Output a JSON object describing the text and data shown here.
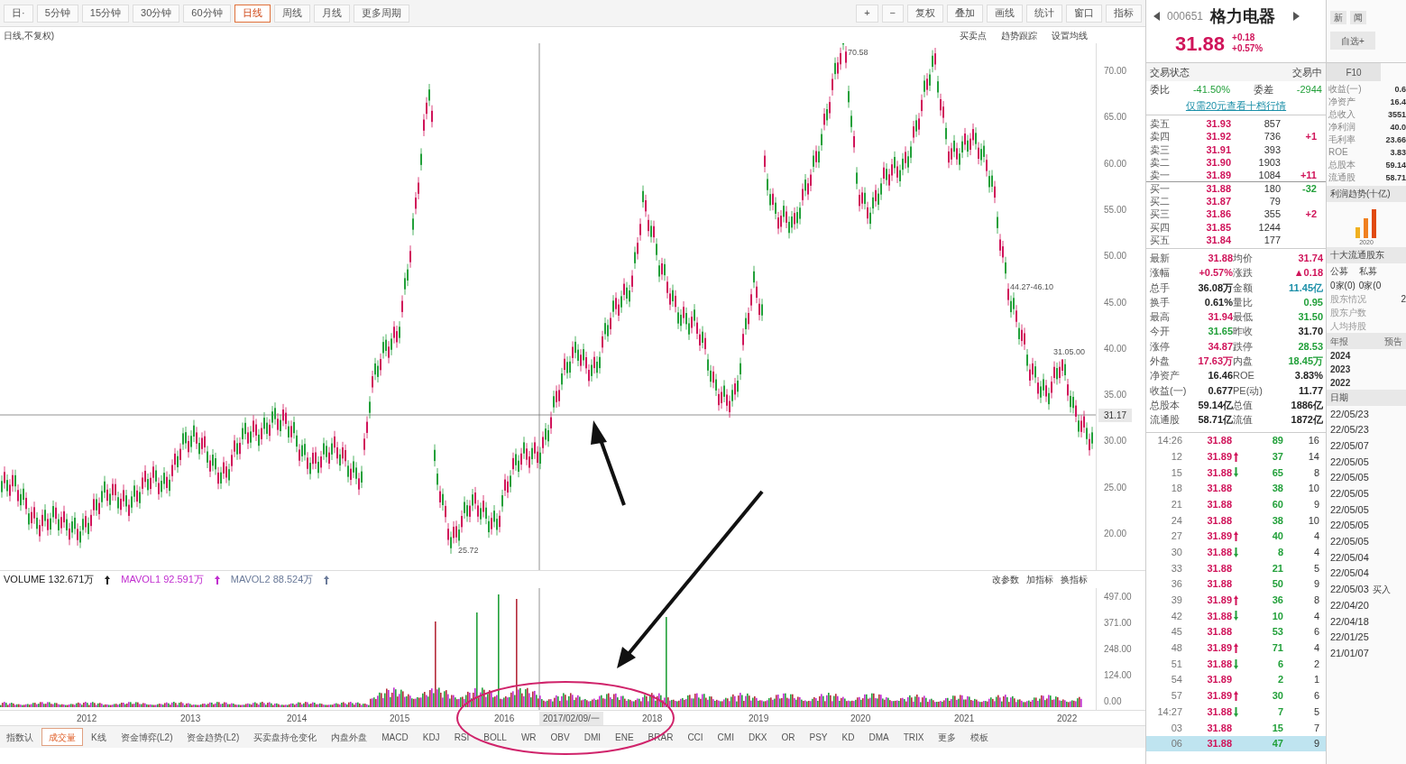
{
  "toolbar": {
    "periods": [
      {
        "label": "日·",
        "selected": false
      },
      {
        "label": "5分钟",
        "selected": false
      },
      {
        "label": "15分钟",
        "selected": false
      },
      {
        "label": "30分钟",
        "selected": false
      },
      {
        "label": "60分钟",
        "selected": false
      },
      {
        "label": "日线",
        "selected": true
      },
      {
        "label": "周线",
        "selected": false
      },
      {
        "label": "月线",
        "selected": false
      },
      {
        "label": "更多周期",
        "selected": false
      }
    ],
    "tools": [
      "+",
      "−",
      "复权",
      "叠加",
      "画线",
      "统计",
      "窗口",
      "指标"
    ]
  },
  "chart_header": {
    "title": "日线,不复权)",
    "options": [
      "买卖点",
      "趋势跟踪",
      "设置均线"
    ]
  },
  "price_chart": {
    "y_labels": [
      "70.00",
      "65.00",
      "60.00",
      "55.00",
      "50.00",
      "45.00",
      "40.00",
      "35.00",
      "30.00",
      "25.00",
      "20.00"
    ],
    "crosshair_price": "31.17",
    "high_label": "70.58",
    "low_label": "25.72",
    "range_label": "44.27-46.10",
    "level_label": "31.05.00"
  },
  "volume_panel": {
    "indicators": [
      {
        "label": "VOLUME 132.671万",
        "color": "#222222"
      },
      {
        "label": "MAVOL1 92.591万",
        "color": "#c02ccf"
      },
      {
        "label": "MAVOL2 88.524万",
        "color": "#6a7a99"
      }
    ],
    "buttons": [
      "改参数",
      "加指标",
      "换指标"
    ],
    "y_labels": [
      "497.00",
      "371.00",
      "248.00",
      "124.00",
      "0.00"
    ]
  },
  "x_axis": {
    "years": [
      "2012",
      "2013",
      "2014",
      "2015",
      "2016",
      "2018",
      "2019",
      "2020",
      "2021",
      "2022"
    ],
    "crosshair_date": "2017/02/09/一"
  },
  "bottom_tabs": [
    {
      "label": "指数认",
      "selected": false
    },
    {
      "label": "成交量",
      "selected": true
    },
    {
      "label": "K线",
      "selected": false
    },
    {
      "label": "资金博弈(L2)",
      "selected": false
    },
    {
      "label": "资金趋势(L2)",
      "selected": false
    },
    {
      "label": "买卖盘持仓变化",
      "selected": false
    },
    {
      "label": "内盘外盘",
      "selected": false
    },
    {
      "label": "MACD",
      "selected": false
    },
    {
      "label": "KDJ",
      "selected": false
    },
    {
      "label": "RSI",
      "selected": false
    },
    {
      "label": "BOLL",
      "selected": false
    },
    {
      "label": "WR",
      "selected": false
    },
    {
      "label": "OBV",
      "selected": false
    },
    {
      "label": "DMI",
      "selected": false
    },
    {
      "label": "ENE",
      "selected": false
    },
    {
      "label": "BRAR",
      "selected": false
    },
    {
      "label": "CCI",
      "selected": false
    },
    {
      "label": "CMI",
      "selected": false
    },
    {
      "label": "DKX",
      "selected": false
    },
    {
      "label": "OR",
      "selected": false
    },
    {
      "label": "PSY",
      "selected": false
    },
    {
      "label": "KD",
      "selected": false
    },
    {
      "label": "DMA",
      "selected": false
    },
    {
      "label": "TRIX",
      "selected": false
    },
    {
      "label": "更多",
      "selected": false
    },
    {
      "label": "模板",
      "selected": false
    }
  ],
  "quote": {
    "code": "000651",
    "name": "格力电器",
    "price": "31.88",
    "change": "+0.18",
    "change_pct": "+0.57%",
    "status_label": "交易状态",
    "status": "交易中",
    "ratio": [
      {
        "label": "委比",
        "value": "-41.50%"
      },
      {
        "label": "委差",
        "value": "-2944"
      }
    ],
    "link": "仅需20元查看十档行情",
    "orders": [
      {
        "label": "卖五",
        "price": "31.93",
        "volume": "857"
      },
      {
        "label": "卖四",
        "price": "31.92",
        "volume": "736",
        "change": "+1",
        "color": "#d0145a"
      },
      {
        "label": "卖三",
        "price": "31.91",
        "volume": "393"
      },
      {
        "label": "卖二",
        "price": "31.90",
        "volume": "1903"
      },
      {
        "label": "卖一",
        "price": "31.89",
        "volume": "1084",
        "change": "+11",
        "color": "#d0145a"
      },
      {
        "label": "买一",
        "price": "31.88",
        "volume": "180",
        "change": "-32",
        "color": "#22a03a"
      },
      {
        "label": "买二",
        "price": "31.87",
        "volume": "79"
      },
      {
        "label": "买三",
        "price": "31.86",
        "volume": "355",
        "change": "+2",
        "color": "#d0145a"
      },
      {
        "label": "买四",
        "price": "31.85",
        "volume": "1244"
      },
      {
        "label": "买五",
        "price": "31.84",
        "volume": "177"
      }
    ],
    "stats": [
      [
        {
          "label": "最新",
          "value": "31.88",
          "color": "#d0145a"
        },
        {
          "label": "均价",
          "value": "31.74",
          "color": "#d0145a"
        }
      ],
      [
        {
          "label": "涨幅",
          "value": "+0.57%",
          "color": "#d0145a"
        },
        {
          "label": "涨跌",
          "value": "▲0.18",
          "color": "#d0145a"
        }
      ],
      [
        {
          "label": "总手",
          "value": "36.08万",
          "color": "#222222"
        },
        {
          "label": "金额",
          "value": "11.45亿",
          "color": "#1a8fa8"
        }
      ],
      [
        {
          "label": "换手",
          "value": "0.61%",
          "color": "#222222"
        },
        {
          "label": "量比",
          "value": "0.95",
          "color": "#22a03a"
        }
      ],
      [
        {
          "label": "最高",
          "value": "31.94",
          "color": "#d0145a"
        },
        {
          "label": "最低",
          "value": "31.50",
          "color": "#22a03a"
        }
      ],
      [
        {
          "label": "今开",
          "value": "31.65",
          "color": "#22a03a"
        },
        {
          "label": "昨收",
          "value": "31.70",
          "color": "#222222"
        }
      ],
      [
        {
          "label": "涨停",
          "value": "34.87",
          "color": "#d0145a"
        },
        {
          "label": "跌停",
          "value": "28.53",
          "color": "#22a03a"
        }
      ],
      [
        {
          "label": "外盘",
          "value": "17.63万",
          "color": "#d0145a"
        },
        {
          "label": "内盘",
          "value": "18.45万",
          "color": "#22a03a"
        }
      ],
      [
        {
          "label": "净资产",
          "value": "16.46",
          "color": "#222222"
        },
        {
          "label": "ROE",
          "value": "3.83%",
          "color": "#222222"
        }
      ],
      [
        {
          "label": "收益(一)",
          "value": "0.677",
          "color": "#222222"
        },
        {
          "label": "PE(动)",
          "value": "11.77",
          "color": "#222222"
        }
      ],
      [
        {
          "label": "总股本",
          "value": "59.14亿",
          "color": "#222222"
        },
        {
          "label": "总值",
          "value": "1886亿",
          "color": "#222222"
        }
      ],
      [
        {
          "label": "流通股",
          "value": "58.71亿",
          "color": "#222222"
        },
        {
          "label": "流值",
          "value": "1872亿",
          "color": "#222222"
        }
      ]
    ],
    "ticks": [
      {
        "time": "14:26",
        "price": "31.88",
        "kind": "flat",
        "volume": "89",
        "count": "16",
        "selected": false
      },
      {
        "time": "12",
        "price": "31.89",
        "kind": "up",
        "volume": "37",
        "count": "14",
        "selected": false
      },
      {
        "time": "15",
        "price": "31.88",
        "kind": "down",
        "volume": "65",
        "count": "8",
        "selected": false
      },
      {
        "time": "18",
        "price": "31.88",
        "kind": "flat",
        "volume": "38",
        "count": "10",
        "selected": false
      },
      {
        "time": "21",
        "price": "31.88",
        "kind": "flat",
        "volume": "60",
        "count": "9",
        "selected": false
      },
      {
        "time": "24",
        "price": "31.88",
        "kind": "flat",
        "volume": "38",
        "count": "10",
        "selected": false
      },
      {
        "time": "27",
        "price": "31.89",
        "kind": "up",
        "volume": "40",
        "count": "4",
        "selected": false
      },
      {
        "time": "30",
        "price": "31.88",
        "kind": "down",
        "volume": "8",
        "count": "4",
        "selected": false
      },
      {
        "time": "33",
        "price": "31.88",
        "kind": "flat",
        "volume": "21",
        "count": "5",
        "selected": false
      },
      {
        "time": "36",
        "price": "31.88",
        "kind": "flat",
        "volume": "50",
        "count": "9",
        "selected": false
      },
      {
        "time": "39",
        "price": "31.89",
        "kind": "up",
        "volume": "36",
        "count": "8",
        "selected": false
      },
      {
        "time": "42",
        "price": "31.88",
        "kind": "down",
        "volume": "10",
        "count": "4",
        "selected": false
      },
      {
        "time": "45",
        "price": "31.88",
        "kind": "flat",
        "volume": "53",
        "count": "6",
        "selected": false
      },
      {
        "time": "48",
        "price": "31.89",
        "kind": "up",
        "volume": "71",
        "count": "4",
        "selected": false
      },
      {
        "time": "51",
        "price": "31.88",
        "kind": "down",
        "volume": "6",
        "count": "2",
        "selected": false
      },
      {
        "time": "54",
        "price": "31.89",
        "kind": "flat",
        "volume": "2",
        "count": "1",
        "selected": false
      },
      {
        "time": "57",
        "price": "31.89",
        "kind": "up",
        "volume": "30",
        "count": "6",
        "selected": false
      },
      {
        "time": "14:27",
        "price": "31.88",
        "kind": "down",
        "volume": "7",
        "count": "5",
        "selected": false
      },
      {
        "time": "03",
        "price": "31.88",
        "kind": "flat",
        "volume": "15",
        "count": "7",
        "selected": false
      },
      {
        "time": "06",
        "price": "31.88",
        "kind": "flat",
        "volume": "47",
        "count": "9",
        "selected": true
      }
    ]
  },
  "side": {
    "buttons": [
      "新",
      "闻",
      "自选+"
    ],
    "tab": "F10",
    "finance": [
      {
        "label": "收益(一)",
        "value": "0.6"
      },
      {
        "label": "净资产",
        "value": "16.4"
      },
      {
        "label": "总收入",
        "value": "3551"
      },
      {
        "label": "净利润",
        "value": "40.0"
      },
      {
        "label": "毛利率",
        "value": "23.66"
      },
      {
        "label": "ROE",
        "value": "3.83"
      },
      {
        "label": "总股本",
        "value": "59.14"
      },
      {
        "label": "流通股",
        "value": "58.71"
      }
    ],
    "trend_title": "利润趋势(十亿)",
    "trend_year": "2020",
    "holders_title": "十大流通股东",
    "holder_cols": [
      "公募",
      "私募"
    ],
    "holder_vals": [
      "0家(0)",
      "0家(0"
    ],
    "holder_rows": [
      {
        "label": "股东情况",
        "value": "2"
      },
      {
        "label": "股东户数"
      },
      {
        "label": "人均持股"
      }
    ],
    "report_head": [
      "年报",
      "预告"
    ],
    "years": [
      "2024",
      "2023",
      "2022"
    ],
    "date_head": "日期",
    "dates": [
      "22/05/23",
      "22/05/23",
      "22/05/07",
      "22/05/05",
      "22/05/05",
      "22/05/05",
      "22/05/05",
      "22/05/05",
      "22/05/05",
      "22/05/04",
      "22/05/04",
      "22/05/03",
      "22/04/20",
      "22/04/18",
      "22/01/25",
      "21/01/07"
    ],
    "trade_label": "买入"
  }
}
